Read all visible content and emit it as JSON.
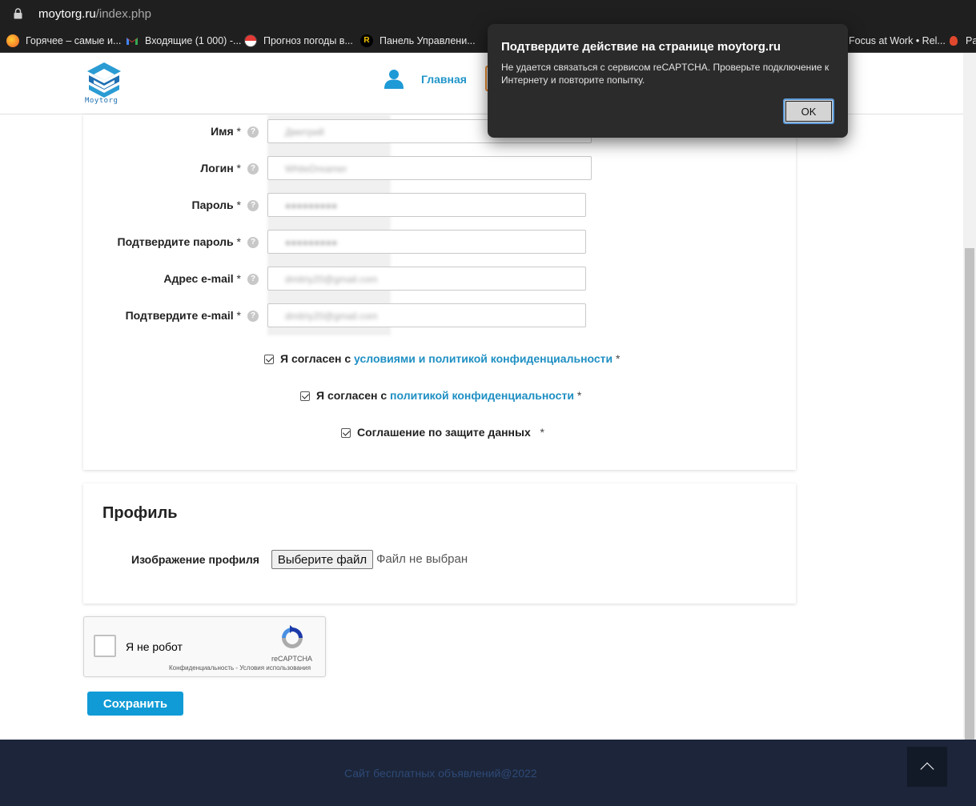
{
  "browser": {
    "url_host": "moytorg.ru",
    "url_path": "/index.php",
    "bookmarks": [
      {
        "label": "Горячее – самые и...",
        "icon": "flame-icon"
      },
      {
        "label": "Входящие (1 000) -...",
        "icon": "gmail-icon"
      },
      {
        "label": "Прогноз погоды в...",
        "icon": "weather-icon"
      },
      {
        "label": "Панель Управлени...",
        "icon": "panel-icon"
      },
      {
        "label": "Focus at Work • Rel...",
        "icon": "focus-icon"
      },
      {
        "label": "Pa",
        "icon": "bookmark-icon"
      }
    ]
  },
  "header": {
    "logo_text": "Moytorg",
    "nav_home": "Главная"
  },
  "form": {
    "fields": [
      {
        "label": "Имя",
        "star": "*",
        "value": "Дмитрий"
      },
      {
        "label": "Логин",
        "star": "*",
        "value": "WhiteDreamer"
      },
      {
        "label": "Пароль",
        "star": "*",
        "value": "●●●●●●●●●"
      },
      {
        "label": "Подтвердите пароль",
        "star": "*",
        "value": "●●●●●●●●●"
      },
      {
        "label": "Адрес e-mail",
        "star": "*",
        "value": "dmitriy20@gmail.com"
      },
      {
        "label": "Подтвердите e-mail",
        "star": "*",
        "value": "dmitriy20@gmail.com"
      }
    ],
    "help_symbol": "?",
    "agree1_prefix": "Я согласен с",
    "agree1_link": "условиями и политикой конфиденциальности",
    "agree2_prefix": "Я согласен с",
    "agree2_link": "политикой конфиденциальности",
    "agree3_text": "Соглашение по защите данных",
    "star": "*"
  },
  "profile": {
    "title": "Профиль",
    "avatar_label": "Изображение профиля",
    "file_button": "Выберите файл",
    "file_status": "Файл не выбран"
  },
  "recaptcha": {
    "label": "Я не робот",
    "brand": "reCAPTCHA",
    "links": "Конфиденциальность - Условия использования"
  },
  "save_button": "Сохранить",
  "footer": {
    "text": "Сайт бесплатных объявлений@2022"
  },
  "dialog": {
    "title": "Подтвердите действие на странице moytorg.ru",
    "message": "Не удается связаться с сервисом reCAPTCHA. Проверьте подключение к Интернету и повторите попытку.",
    "ok_button": "OK"
  },
  "colors": {
    "accent": "#109bd6",
    "link": "#1e8fc3",
    "footer_bg": "#1c2539",
    "dialog_bg": "#2b2b2b"
  }
}
